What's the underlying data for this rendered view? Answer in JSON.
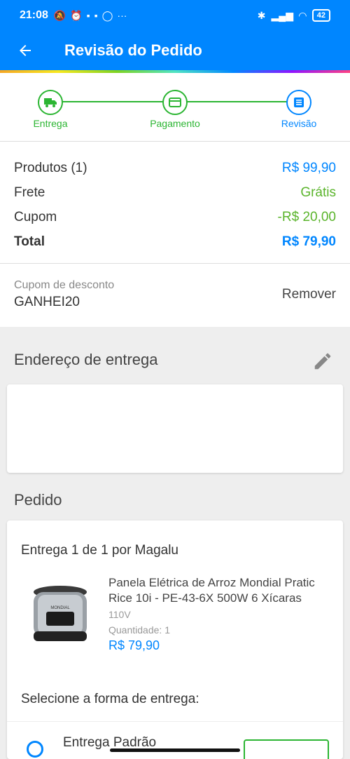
{
  "status_bar": {
    "time": "21:08",
    "battery": "42"
  },
  "toolbar": {
    "title": "Revisão do Pedido"
  },
  "stepper": {
    "steps": [
      {
        "label": "Entrega"
      },
      {
        "label": "Pagamento"
      },
      {
        "label": "Revisão"
      }
    ]
  },
  "summary": {
    "rows": [
      {
        "label": "Produtos (1)",
        "value": "R$ 99,90"
      },
      {
        "label": "Frete",
        "value": "Grátis"
      },
      {
        "label": "Cupom",
        "value": "-R$ 20,00"
      },
      {
        "label": "Total",
        "value": "R$ 79,90"
      }
    ]
  },
  "coupon": {
    "label": "Cupom de desconto",
    "code": "GANHEI20",
    "remove_label": "Remover"
  },
  "address": {
    "title": "Endereço de entrega"
  },
  "order": {
    "title": "Pedido",
    "shipment": "Entrega 1 de 1 por Magalu",
    "product": {
      "name": "Panela Elétrica de Arroz Mondial Pratic Rice 10i - PE-43-6X 500W 6 Xícaras",
      "voltage": "110V",
      "quantity_label": "Quantidade:",
      "quantity": "1",
      "price": "R$ 79,90",
      "brand_on_image": "MONDIAL"
    },
    "select_shipping": "Selecione a forma de entrega:",
    "shipping_option": "Entrega Padrão"
  },
  "colors": {
    "primary": "#0086ff",
    "success": "#2bb532",
    "discount": "#5ab42b"
  }
}
